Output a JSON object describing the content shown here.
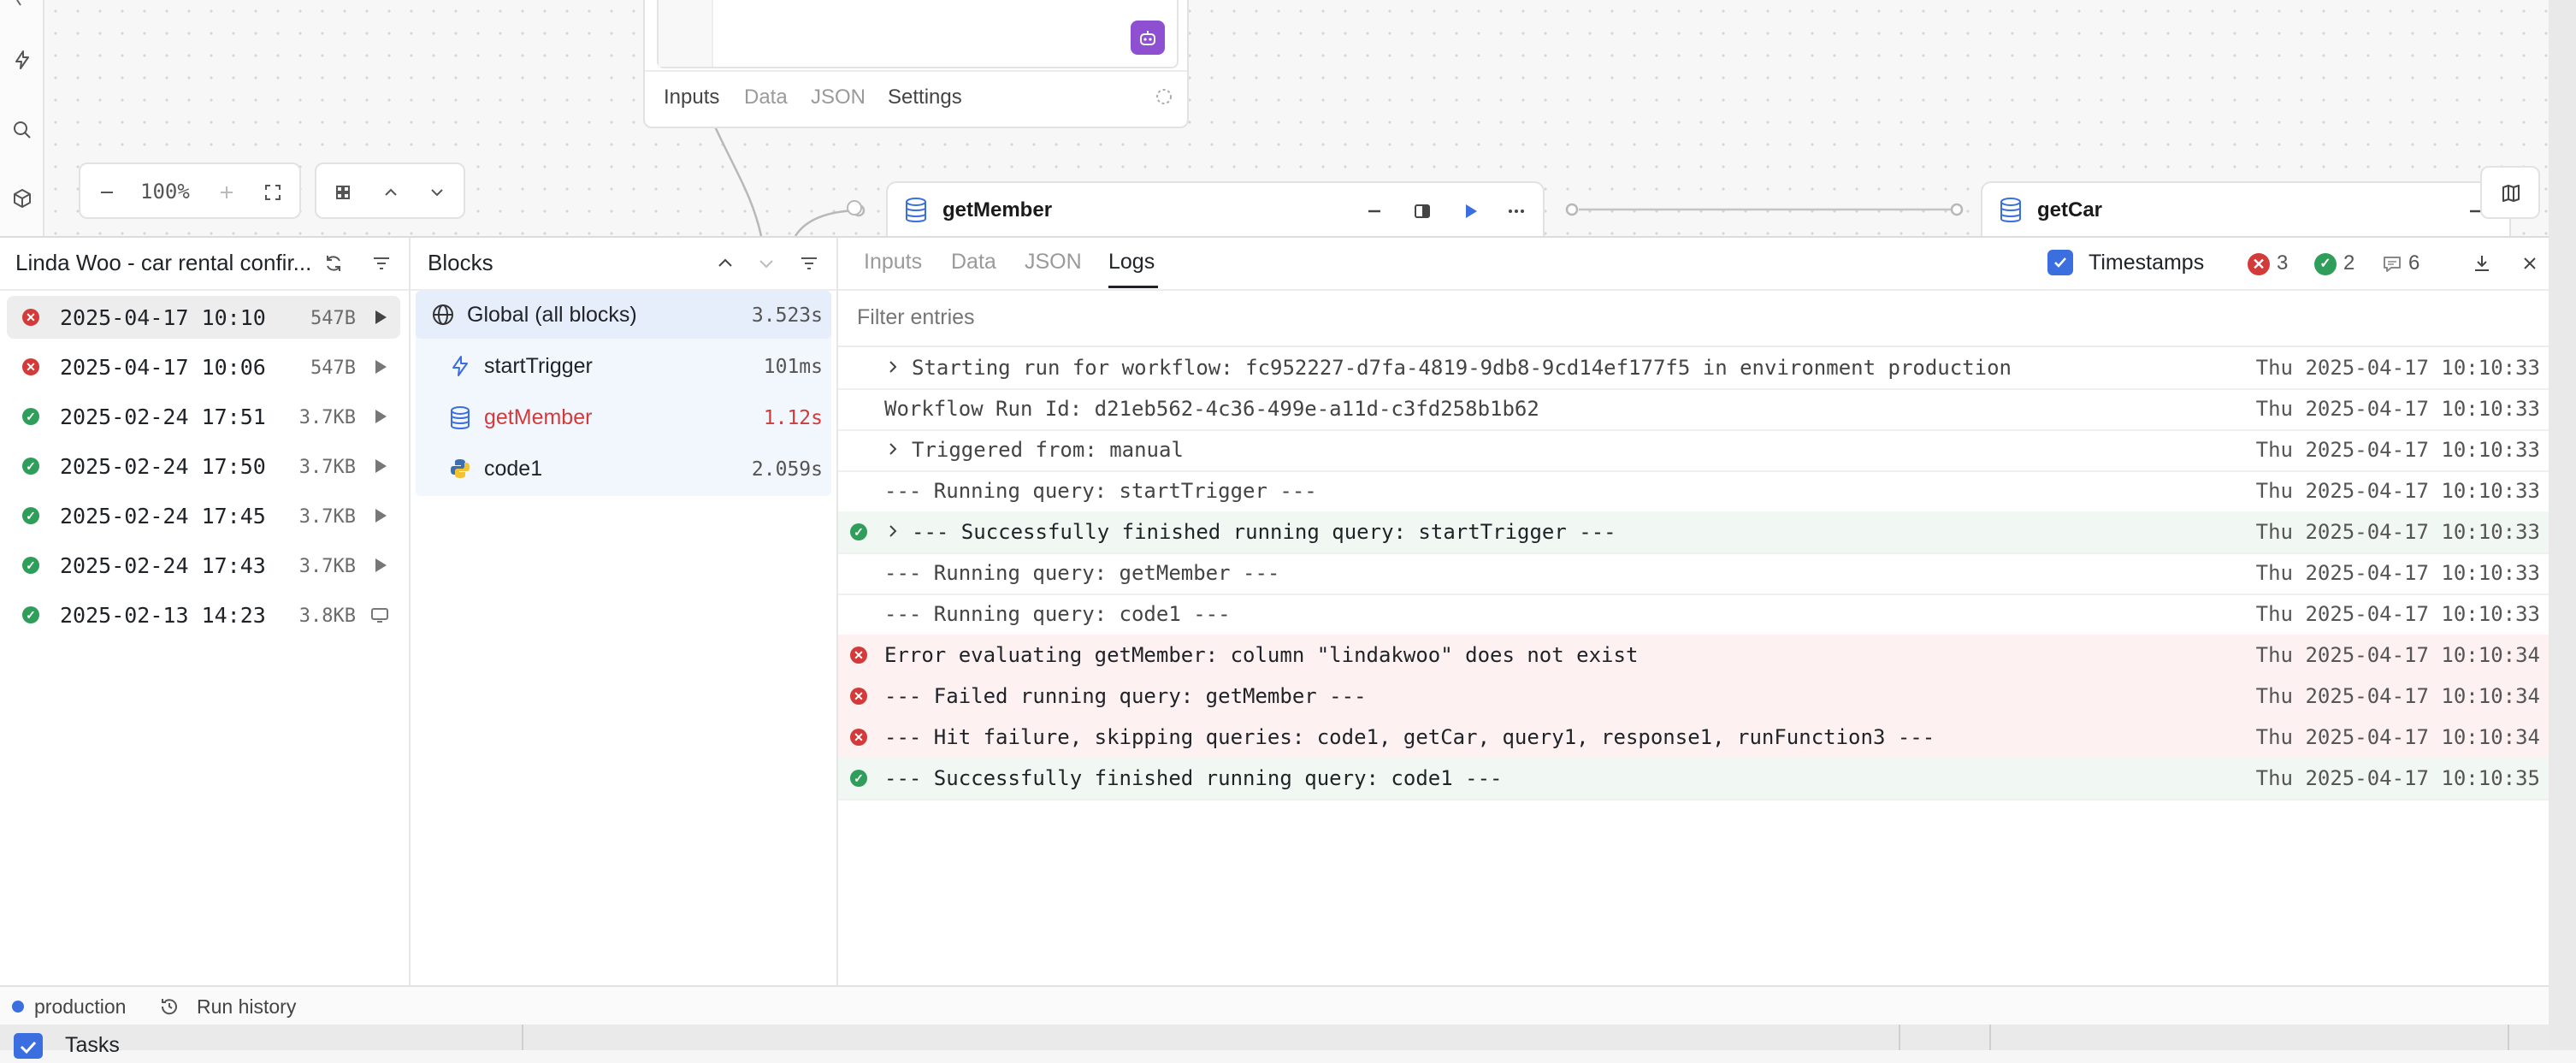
{
  "canvas": {
    "query_card_tabs": [
      "Inputs",
      "Data",
      "JSON",
      "Settings"
    ],
    "zoom": {
      "value": "100%"
    },
    "nodes": {
      "getMember": {
        "title": "getMember"
      },
      "getCar": {
        "title": "getCar"
      }
    },
    "rail_icons": [
      "lightning-icon",
      "search-icon",
      "cube-icon"
    ]
  },
  "runs": {
    "title": "Linda Woo - car rental confir...",
    "items": [
      {
        "date": "2025-04-17 10:10",
        "size": "547B",
        "status": "error",
        "action": "play",
        "active": true
      },
      {
        "date": "2025-04-17 10:06",
        "size": "547B",
        "status": "error",
        "action": "play",
        "active": false
      },
      {
        "date": "2025-02-24 17:51",
        "size": "3.7KB",
        "status": "success",
        "action": "play",
        "active": false
      },
      {
        "date": "2025-02-24 17:50",
        "size": "3.7KB",
        "status": "success",
        "action": "play",
        "active": false
      },
      {
        "date": "2025-02-24 17:45",
        "size": "3.7KB",
        "status": "success",
        "action": "play",
        "active": false
      },
      {
        "date": "2025-02-24 17:43",
        "size": "3.7KB",
        "status": "success",
        "action": "play",
        "active": false
      },
      {
        "date": "2025-02-13 14:23",
        "size": "3.8KB",
        "status": "success",
        "action": "monitor",
        "active": false
      }
    ]
  },
  "blocks": {
    "title": "Blocks",
    "items": [
      {
        "name": "Global (all blocks)",
        "time": "3.523s",
        "icon": "globe-icon",
        "error": false
      },
      {
        "name": "startTrigger",
        "time": "101ms",
        "icon": "lightning-icon",
        "error": false
      },
      {
        "name": "getMember",
        "time": "1.12s",
        "icon": "database-icon",
        "error": true
      },
      {
        "name": "code1",
        "time": "2.059s",
        "icon": "python-icon",
        "error": false
      }
    ]
  },
  "logs": {
    "tabs": [
      "Inputs",
      "Data",
      "JSON",
      "Logs"
    ],
    "active_tab": "Logs",
    "timestamps_label": "Timestamps",
    "counts": {
      "errors": "3",
      "success": "2",
      "messages": "6"
    },
    "filter_placeholder": "Filter entries",
    "entries": [
      {
        "msg": "Starting run for workflow: fc952227-d7fa-4819-9db8-9cd14ef177f5 in environment production",
        "time": "Thu 2025-04-17 10:10:33",
        "status": "none",
        "expandable": true
      },
      {
        "msg": "Workflow Run Id: d21eb562-4c36-499e-a11d-c3fd258b1b62",
        "time": "Thu 2025-04-17 10:10:33",
        "status": "none",
        "expandable": false
      },
      {
        "msg": "Triggered from: manual",
        "time": "Thu 2025-04-17 10:10:33",
        "status": "none",
        "expandable": true
      },
      {
        "msg": "--- Running query: startTrigger ---",
        "time": "Thu 2025-04-17 10:10:33",
        "status": "none",
        "expandable": false
      },
      {
        "msg": "--- Successfully finished running query: startTrigger ---",
        "time": "Thu 2025-04-17 10:10:33",
        "status": "success",
        "expandable": true
      },
      {
        "msg": "--- Running query: getMember ---",
        "time": "Thu 2025-04-17 10:10:33",
        "status": "none",
        "expandable": false
      },
      {
        "msg": "--- Running query: code1 ---",
        "time": "Thu 2025-04-17 10:10:33",
        "status": "none",
        "expandable": false
      },
      {
        "msg": "Error evaluating getMember: column \"lindakwoo\" does not exist",
        "time": "Thu 2025-04-17 10:10:34",
        "status": "error",
        "expandable": false
      },
      {
        "msg": "--- Failed running query: getMember ---",
        "time": "Thu 2025-04-17 10:10:34",
        "status": "error",
        "expandable": false
      },
      {
        "msg": "--- Hit failure, skipping queries: code1, getCar, query1, response1, runFunction3 ---",
        "time": "Thu 2025-04-17 10:10:34",
        "status": "error",
        "expandable": false
      },
      {
        "msg": "--- Successfully finished running query: code1 ---",
        "time": "Thu 2025-04-17 10:10:35",
        "status": "success",
        "expandable": false
      }
    ]
  },
  "footer": {
    "environment": "production",
    "run_history": "Run history"
  },
  "under": {
    "tasks_label": "Tasks"
  },
  "colors": {
    "accent": "#3b6fe0",
    "error": "#d33b3b",
    "success": "#2f9e5a",
    "purple": "#8e4fd0"
  }
}
